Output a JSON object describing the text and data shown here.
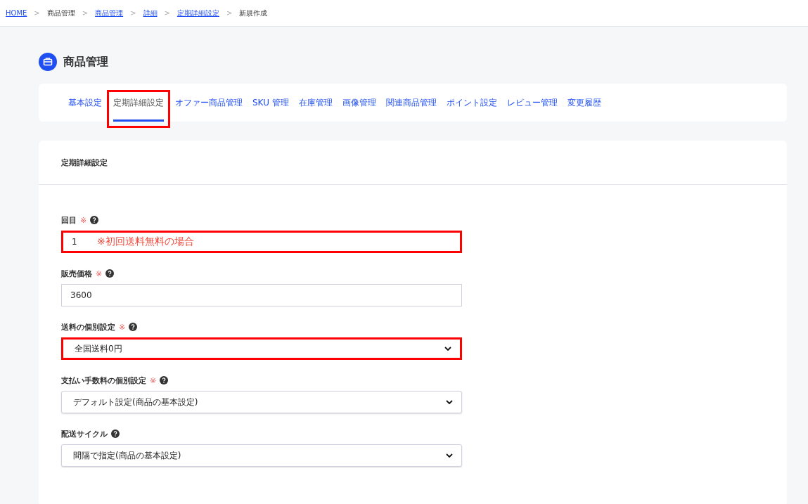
{
  "breadcrumb": [
    {
      "label": "HOME",
      "link": true
    },
    {
      "label": "商品管理",
      "link": false
    },
    {
      "label": "商品管理",
      "link": true
    },
    {
      "label": "詳細",
      "link": true
    },
    {
      "label": "定期詳細設定",
      "link": true
    },
    {
      "label": "新規作成",
      "link": false
    }
  ],
  "breadcrumb_separator": ">",
  "page_title": "商品管理",
  "tabs": [
    {
      "label": "基本設定",
      "selected": false,
      "highlighted": false
    },
    {
      "label": "定期詳細設定",
      "selected": true,
      "highlighted": true
    },
    {
      "label": "オファー商品管理",
      "selected": false,
      "highlighted": false
    },
    {
      "label": "SKU 管理",
      "selected": false,
      "highlighted": false
    },
    {
      "label": "在庫管理",
      "selected": false,
      "highlighted": false
    },
    {
      "label": "画像管理",
      "selected": false,
      "highlighted": false
    },
    {
      "label": "関連商品管理",
      "selected": false,
      "highlighted": false
    },
    {
      "label": "ポイント設定",
      "selected": false,
      "highlighted": false
    },
    {
      "label": "レビュー管理",
      "selected": false,
      "highlighted": false
    },
    {
      "label": "変更履歴",
      "selected": false,
      "highlighted": false
    }
  ],
  "section_title": "定期詳細設定",
  "fields": [
    {
      "kind": "input",
      "label": "回目",
      "required_mark": "※",
      "value": "1",
      "highlighted": true,
      "annotation": "※初回送料無料の場合"
    },
    {
      "kind": "input",
      "label": "販売価格",
      "required_mark": "※",
      "value": "3600",
      "highlighted": false
    },
    {
      "kind": "select",
      "label": "送料の個別設定",
      "required_mark": "※",
      "value": "全国送料0円",
      "highlighted": true
    },
    {
      "kind": "select",
      "label": "支払い手数料の個別設定",
      "required_mark": "※",
      "value": "デフォルト設定(商品の基本設定)",
      "highlighted": false
    },
    {
      "kind": "select",
      "label": "配送サイクル",
      "value": "間隔で指定(商品の基本設定)",
      "highlighted": false
    }
  ]
}
